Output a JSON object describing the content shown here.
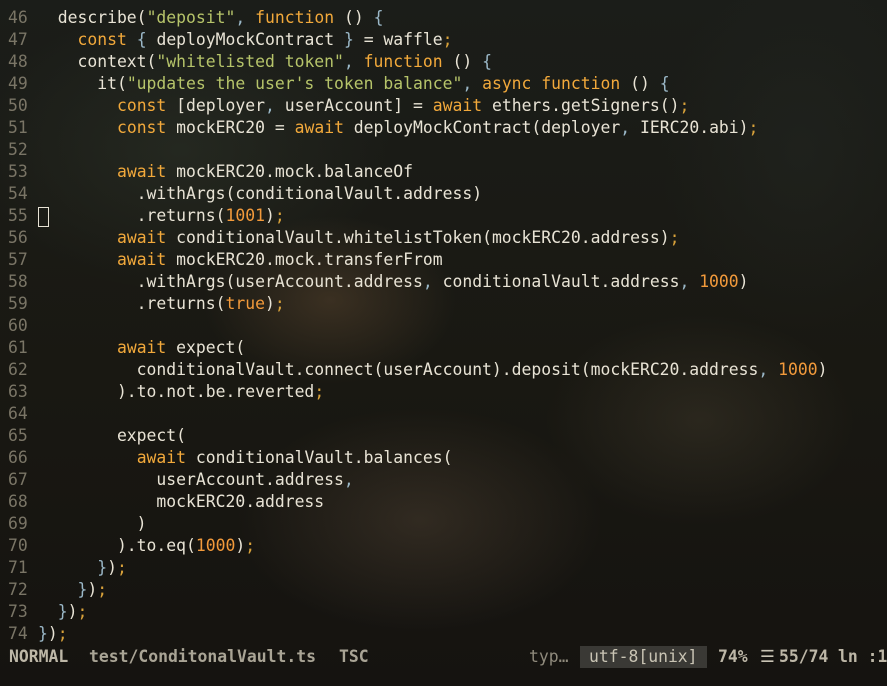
{
  "editor": {
    "lines": [
      {
        "n": "46",
        "tokens": [
          [
            "",
            "  describe("
          ],
          [
            "s",
            "\"deposit\""
          ],
          [
            "p",
            ", "
          ],
          [
            "k",
            "function"
          ],
          [
            "",
            " () "
          ],
          [
            "p",
            "{"
          ]
        ]
      },
      {
        "n": "47",
        "tokens": [
          [
            "",
            "    "
          ],
          [
            "k",
            "const"
          ],
          [
            "",
            " "
          ],
          [
            "p",
            "{"
          ],
          [
            "",
            " deployMockContract "
          ],
          [
            "p",
            "}"
          ],
          [
            "",
            " = waffle"
          ],
          [
            "d",
            ";"
          ]
        ]
      },
      {
        "n": "48",
        "tokens": [
          [
            "",
            "    context("
          ],
          [
            "s",
            "\"whitelisted token\""
          ],
          [
            "p",
            ", "
          ],
          [
            "k",
            "function"
          ],
          [
            "",
            " () "
          ],
          [
            "p",
            "{"
          ]
        ]
      },
      {
        "n": "49",
        "tokens": [
          [
            "",
            "      it("
          ],
          [
            "s",
            "\"updates the user's token balance\""
          ],
          [
            "p",
            ", "
          ],
          [
            "k",
            "async function"
          ],
          [
            "",
            " () "
          ],
          [
            "p",
            "{"
          ]
        ]
      },
      {
        "n": "50",
        "tokens": [
          [
            "",
            "        "
          ],
          [
            "k",
            "const"
          ],
          [
            "",
            " [deployer"
          ],
          [
            "p",
            ","
          ],
          [
            "",
            " userAccount] = "
          ],
          [
            "k",
            "await"
          ],
          [
            "",
            " ethers.getSigners()"
          ],
          [
            "d",
            ";"
          ]
        ]
      },
      {
        "n": "51",
        "tokens": [
          [
            "",
            "        "
          ],
          [
            "k",
            "const"
          ],
          [
            "",
            " mockERC20 = "
          ],
          [
            "k",
            "await"
          ],
          [
            "",
            " deployMockContract(deployer"
          ],
          [
            "p",
            ","
          ],
          [
            "",
            " IERC20.abi)"
          ],
          [
            "d",
            ";"
          ]
        ]
      },
      {
        "n": "52",
        "tokens": []
      },
      {
        "n": "53",
        "tokens": [
          [
            "",
            "        "
          ],
          [
            "k",
            "await"
          ],
          [
            "",
            " mockERC20.mock.balanceOf"
          ]
        ]
      },
      {
        "n": "54",
        "tokens": [
          [
            "",
            "          .withArgs(conditionalVault.address)"
          ]
        ]
      },
      {
        "n": "55",
        "tokens": [
          [
            "",
            "          .returns("
          ],
          [
            "n",
            "1001"
          ],
          [
            "",
            ")"
          ],
          [
            "d",
            ";"
          ]
        ]
      },
      {
        "n": "56",
        "tokens": [
          [
            "",
            "        "
          ],
          [
            "k",
            "await"
          ],
          [
            "",
            " conditionalVault.whitelistToken(mockERC20.address)"
          ],
          [
            "d",
            ";"
          ]
        ]
      },
      {
        "n": "57",
        "tokens": [
          [
            "",
            "        "
          ],
          [
            "k",
            "await"
          ],
          [
            "",
            " mockERC20.mock.transferFrom"
          ]
        ]
      },
      {
        "n": "58",
        "tokens": [
          [
            "",
            "          .withArgs(userAccount.address"
          ],
          [
            "p",
            ","
          ],
          [
            "",
            " conditionalVault.address"
          ],
          [
            "p",
            ","
          ],
          [
            "",
            " "
          ],
          [
            "n",
            "1000"
          ],
          [
            "",
            ")"
          ]
        ]
      },
      {
        "n": "59",
        "tokens": [
          [
            "",
            "          .returns("
          ],
          [
            "n",
            "true"
          ],
          [
            "",
            ")"
          ],
          [
            "d",
            ";"
          ]
        ]
      },
      {
        "n": "60",
        "tokens": []
      },
      {
        "n": "61",
        "tokens": [
          [
            "",
            "        "
          ],
          [
            "k",
            "await"
          ],
          [
            "",
            " expect("
          ]
        ]
      },
      {
        "n": "62",
        "tokens": [
          [
            "",
            "          conditionalVault.connect(userAccount).deposit(mockERC20.address"
          ],
          [
            "p",
            ","
          ],
          [
            "",
            " "
          ],
          [
            "n",
            "1000"
          ],
          [
            "",
            ")"
          ]
        ]
      },
      {
        "n": "63",
        "tokens": [
          [
            "",
            "        ).to.not.be.reverted"
          ],
          [
            "d",
            ";"
          ]
        ]
      },
      {
        "n": "64",
        "tokens": []
      },
      {
        "n": "65",
        "tokens": [
          [
            "",
            "        expect("
          ]
        ]
      },
      {
        "n": "66",
        "tokens": [
          [
            "",
            "          "
          ],
          [
            "k",
            "await"
          ],
          [
            "",
            " conditionalVault.balances("
          ]
        ]
      },
      {
        "n": "67",
        "tokens": [
          [
            "",
            "            userAccount.address"
          ],
          [
            "p",
            ","
          ]
        ]
      },
      {
        "n": "68",
        "tokens": [
          [
            "",
            "            mockERC20.address"
          ]
        ]
      },
      {
        "n": "69",
        "tokens": [
          [
            "",
            "          )"
          ]
        ]
      },
      {
        "n": "70",
        "tokens": [
          [
            "",
            "        ).to.eq("
          ],
          [
            "n",
            "1000"
          ],
          [
            "",
            ")"
          ],
          [
            "d",
            ";"
          ]
        ]
      },
      {
        "n": "71",
        "tokens": [
          [
            "",
            "      "
          ],
          [
            "p",
            "}"
          ],
          [
            "",
            ")"
          ],
          [
            "d",
            ";"
          ]
        ]
      },
      {
        "n": "72",
        "tokens": [
          [
            "",
            "    "
          ],
          [
            "p",
            "}"
          ],
          [
            "",
            ")"
          ],
          [
            "d",
            ";"
          ]
        ]
      },
      {
        "n": "73",
        "tokens": [
          [
            "",
            "  "
          ],
          [
            "p",
            "}"
          ],
          [
            "",
            ")"
          ],
          [
            "d",
            ";"
          ]
        ]
      },
      {
        "n": "74",
        "tokens": [
          [
            "p",
            "}"
          ],
          [
            "",
            ")"
          ],
          [
            "d",
            ";"
          ]
        ]
      }
    ],
    "cursor_line": "55"
  },
  "statusbar": {
    "mode": "NORMAL",
    "filename": "test/ConditonalVault.ts",
    "filetype": "TSC",
    "typ": "typ…",
    "encoding": "utf-8[unix]",
    "percent": "74%",
    "lines_icon": "☰",
    "position": "55/74",
    "ln_label": "ln :1"
  },
  "colors": {
    "keyword": "#f2a93b",
    "string": "#b6c46a",
    "number": "#f29a3b",
    "foreground": "#e8e3d5",
    "line_number": "#7a7566"
  }
}
